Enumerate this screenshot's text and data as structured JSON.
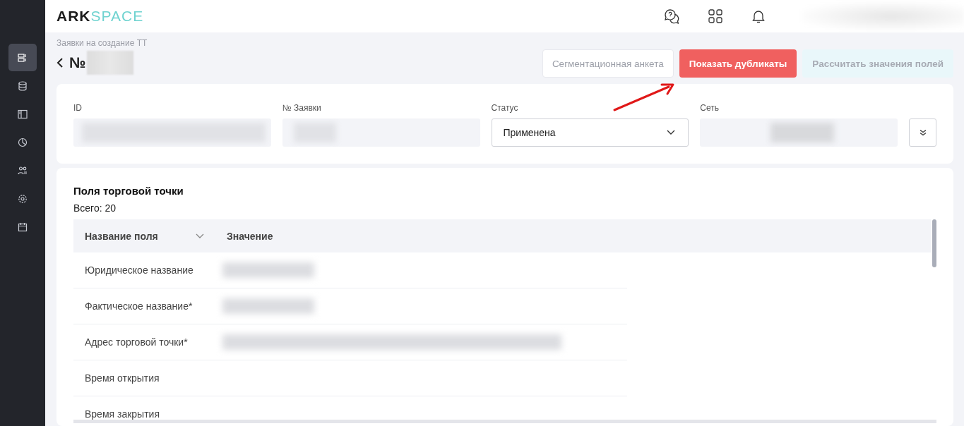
{
  "logo": {
    "dark": "ARK",
    "light": "SPACE"
  },
  "sidebar": {
    "items": [
      {
        "selected": true
      },
      {
        "selected": false
      },
      {
        "selected": false
      },
      {
        "selected": false
      },
      {
        "selected": false
      },
      {
        "selected": false
      },
      {
        "selected": false
      }
    ]
  },
  "breadcrumb": "Заявки на создание ТТ",
  "title": "№",
  "buttons": [
    {
      "label": "Сегментационная анкета",
      "kind": "outline"
    },
    {
      "label": "Показать дубликаты",
      "kind": "primary"
    },
    {
      "label": "Рассчитать значения полей",
      "kind": "disabled"
    }
  ],
  "fields": [
    {
      "label": "ID",
      "kind": "readonly"
    },
    {
      "label": "№ Заявки",
      "kind": "readonly"
    },
    {
      "label": "Статус",
      "kind": "select",
      "value": "Применена"
    },
    {
      "label": "Сеть",
      "kind": "readonly"
    }
  ],
  "section": {
    "title": "Поля торговой точки",
    "total": "Всего: 20"
  },
  "table": {
    "columns": [
      "Название поля",
      "Значение"
    ],
    "rows": [
      {
        "name": "Юридическое название"
      },
      {
        "name": "Фактическое название*"
      },
      {
        "name": "Адрес торговой точки*"
      },
      {
        "name": "Время открытия"
      },
      {
        "name": "Время закрытия"
      }
    ]
  }
}
